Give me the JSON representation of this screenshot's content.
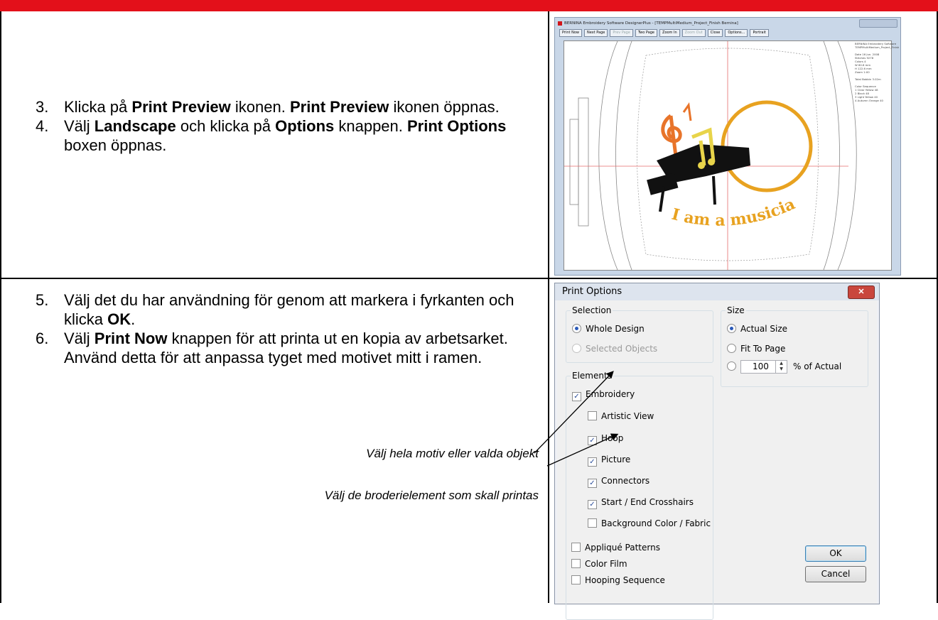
{
  "steps_top": [
    {
      "num": "3.",
      "parts": [
        {
          "t": "Klicka på ",
          "b": false
        },
        {
          "t": "Print Preview",
          "b": true
        },
        {
          "t": " ikonen. ",
          "b": false
        },
        {
          "t": "Print Preview",
          "b": true
        },
        {
          "t": " ikonen öppnas.",
          "b": false
        }
      ]
    },
    {
      "num": "4.",
      "parts": [
        {
          "t": "Välj ",
          "b": false
        },
        {
          "t": "Landscape",
          "b": true
        },
        {
          "t": " och klicka på ",
          "b": false
        },
        {
          "t": "Options",
          "b": true
        },
        {
          "t": " knappen. ",
          "b": false
        },
        {
          "t": "Print Options",
          "b": true
        },
        {
          "t": " boxen öppnas.",
          "b": false
        }
      ]
    }
  ],
  "steps_bottom": [
    {
      "num": "5.",
      "parts": [
        {
          "t": "Välj det du har användning för genom att markera i fyrkanten och klicka ",
          "b": false
        },
        {
          "t": "OK",
          "b": true
        },
        {
          "t": ".",
          "b": false
        }
      ]
    },
    {
      "num": "6.",
      "parts": [
        {
          "t": "Välj ",
          "b": false
        },
        {
          "t": "Print Now",
          "b": true
        },
        {
          "t": " knappen för att printa ut en kopia av arbetsarket. Använd detta för att anpassa tyget med motivet mitt i ramen.",
          "b": false
        }
      ]
    }
  ],
  "annotations": {
    "note1": "Välj hela motiv eller valda objekt",
    "note2": "Välj de broderielement som skall printas"
  },
  "colors": {
    "header_bar": "#e3101a",
    "embroidery_text": "#e8a220",
    "piano": "#111111"
  },
  "preview": {
    "title": "BERNINA Embroidery Software DesignerPlus - [TEMPMultiMedium_Project_Finish    Bernina]",
    "toolbar": [
      "Print Now",
      "Next Page",
      "Prev Page",
      "Two Page",
      "Zoom In",
      "Zoom Out",
      "Close",
      "Options...",
      "Portrait"
    ],
    "toolbar_disabled": [
      "Prev Page",
      "Zoom Out"
    ],
    "embroidery_text": "I am a musician!",
    "info": [
      "BERNINA Embroidery Software",
      "TEMPMultiMedium_Project_Finish",
      "Date         16 Jun. 2008",
      "Stitches     9278",
      "Colors       4",
      "W            80.8 mm",
      "H            122.6 mm",
      "Zoom         1:00",
      "Total Bobbin       3.02m",
      "Color Sequence",
      "1  Clear Yellow 48",
      "2  Black 48",
      "3  Light Yellow 40",
      "4  Autumn Orange 40"
    ]
  },
  "dialog": {
    "title": "Print Options",
    "selection": {
      "label": "Selection",
      "whole_design": "Whole Design",
      "selected_objects": "Selected Objects"
    },
    "size": {
      "label": "Size",
      "actual_size": "Actual Size",
      "fit_to_page": "Fit To Page",
      "percent_value": "100",
      "percent_label": "% of Actual"
    },
    "elements": {
      "label": "Elements",
      "items": [
        {
          "label": "Embroidery",
          "checked": true
        },
        {
          "label": "Artistic View",
          "checked": false
        },
        {
          "label": "Hoop",
          "checked": true
        },
        {
          "label": "Picture",
          "checked": true
        },
        {
          "label": "Connectors",
          "checked": true
        },
        {
          "label": "Start / End Crosshairs",
          "checked": true
        },
        {
          "label": "Background Color / Fabric",
          "checked": false
        }
      ]
    },
    "other_items": [
      {
        "label": "Appliqué Patterns",
        "checked": false
      },
      {
        "label": "Color Film",
        "checked": false
      },
      {
        "label": "Hooping Sequence",
        "checked": false
      }
    ],
    "ok": "OK",
    "cancel": "Cancel"
  }
}
